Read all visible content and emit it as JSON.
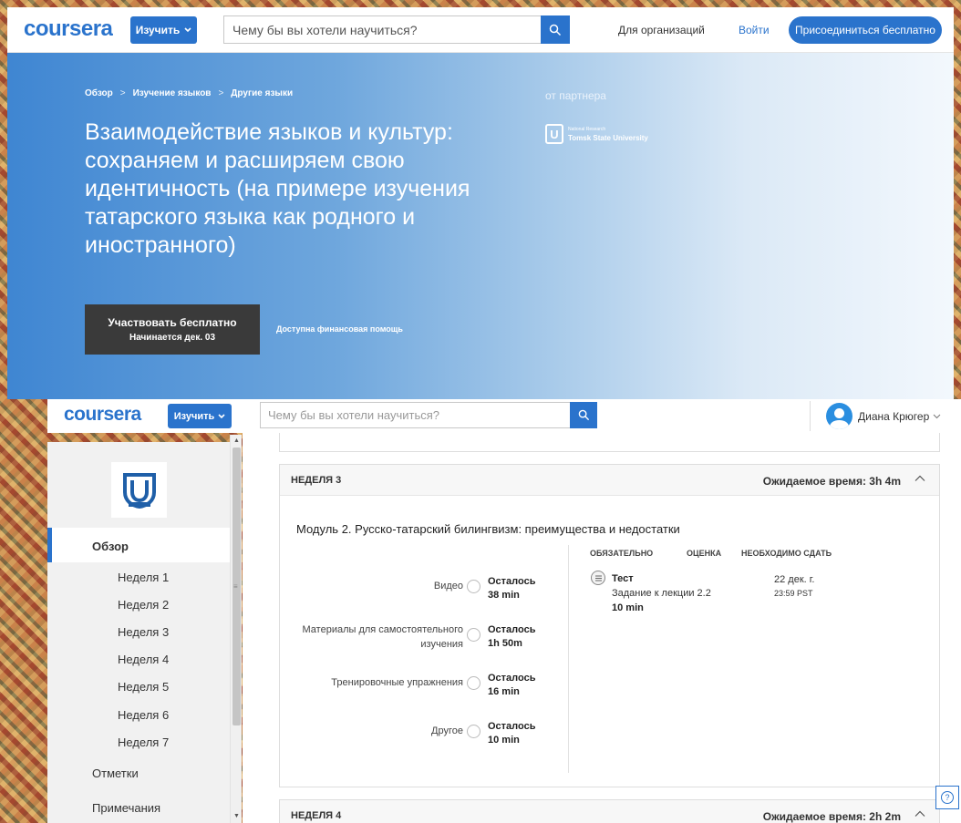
{
  "top_nav": {
    "logo": "coursera",
    "learn_button": "Изучить",
    "search_placeholder": "Чему бы вы хотели научиться?",
    "for_orgs": "Для организаций",
    "login": "Войти",
    "join_button": "Присоединиться бесплатно"
  },
  "hero": {
    "breadcrumbs": [
      "Обзор",
      "Изучение языков",
      "Другие языки"
    ],
    "breadcrumb_separator": ">",
    "title": "Взаимодействие языков и культур: сохраняем и расширяем свою идентичность (на примере изучения татарского языка как родного и иностранного)",
    "partner_label": "от партнера",
    "partner_logo_small": "National Research",
    "partner_logo_name": "Tomsk State University",
    "partner_logo_letter": "U",
    "enroll_line1": "Участвовать бесплатно",
    "enroll_line2": "Начинается дек. 03",
    "financial_aid": "Доступна финансовая помощь"
  },
  "bottom_nav": {
    "logo": "coursera",
    "learn_button": "Изучить",
    "search_placeholder": "Чему бы вы хотели научиться?",
    "user_name": "Диана Крюгер"
  },
  "sidebar": {
    "active": "Обзор",
    "weeks": [
      "Неделя 1",
      "Неделя 2",
      "Неделя 3",
      "Неделя 4",
      "Неделя 5",
      "Неделя 6",
      "Неделя 7"
    ],
    "grades": "Отметки",
    "notes": "Примечания"
  },
  "week3": {
    "name": "НЕДЕЛЯ 3",
    "estimated_time": "Ожидаемое время: 3h 4m",
    "module_title": "Модуль 2. Русско-татарский билингвизм: преимущества и недостатки",
    "materials": [
      {
        "label": "Видео",
        "remain": "Осталось",
        "time": "38 min"
      },
      {
        "label": "Материалы для самостоятельного изучения",
        "remain": "Осталось",
        "time": "1h 50m"
      },
      {
        "label": "Тренировочные упражнения",
        "remain": "Осталось",
        "time": "16 min"
      },
      {
        "label": "Другое",
        "remain": "Осталось",
        "time": "10 min"
      }
    ],
    "columns": [
      "ОБЯЗАТЕЛЬНО",
      "ОЦЕНКА",
      "НЕОБХОДИМО СДАТЬ"
    ],
    "task": {
      "type": "Тест",
      "name": "Задание к лекции 2.2",
      "duration": "10 min",
      "due_date": "22 дек. г.",
      "due_time": "23:59 PST"
    }
  },
  "week4": {
    "name": "НЕДЕЛЯ 4",
    "estimated_time": "Ожидаемое время: 2h 2m"
  },
  "help": "?",
  "colors": {
    "brand": "#2a73cc",
    "enroll_bg": "#3a3a3a"
  }
}
